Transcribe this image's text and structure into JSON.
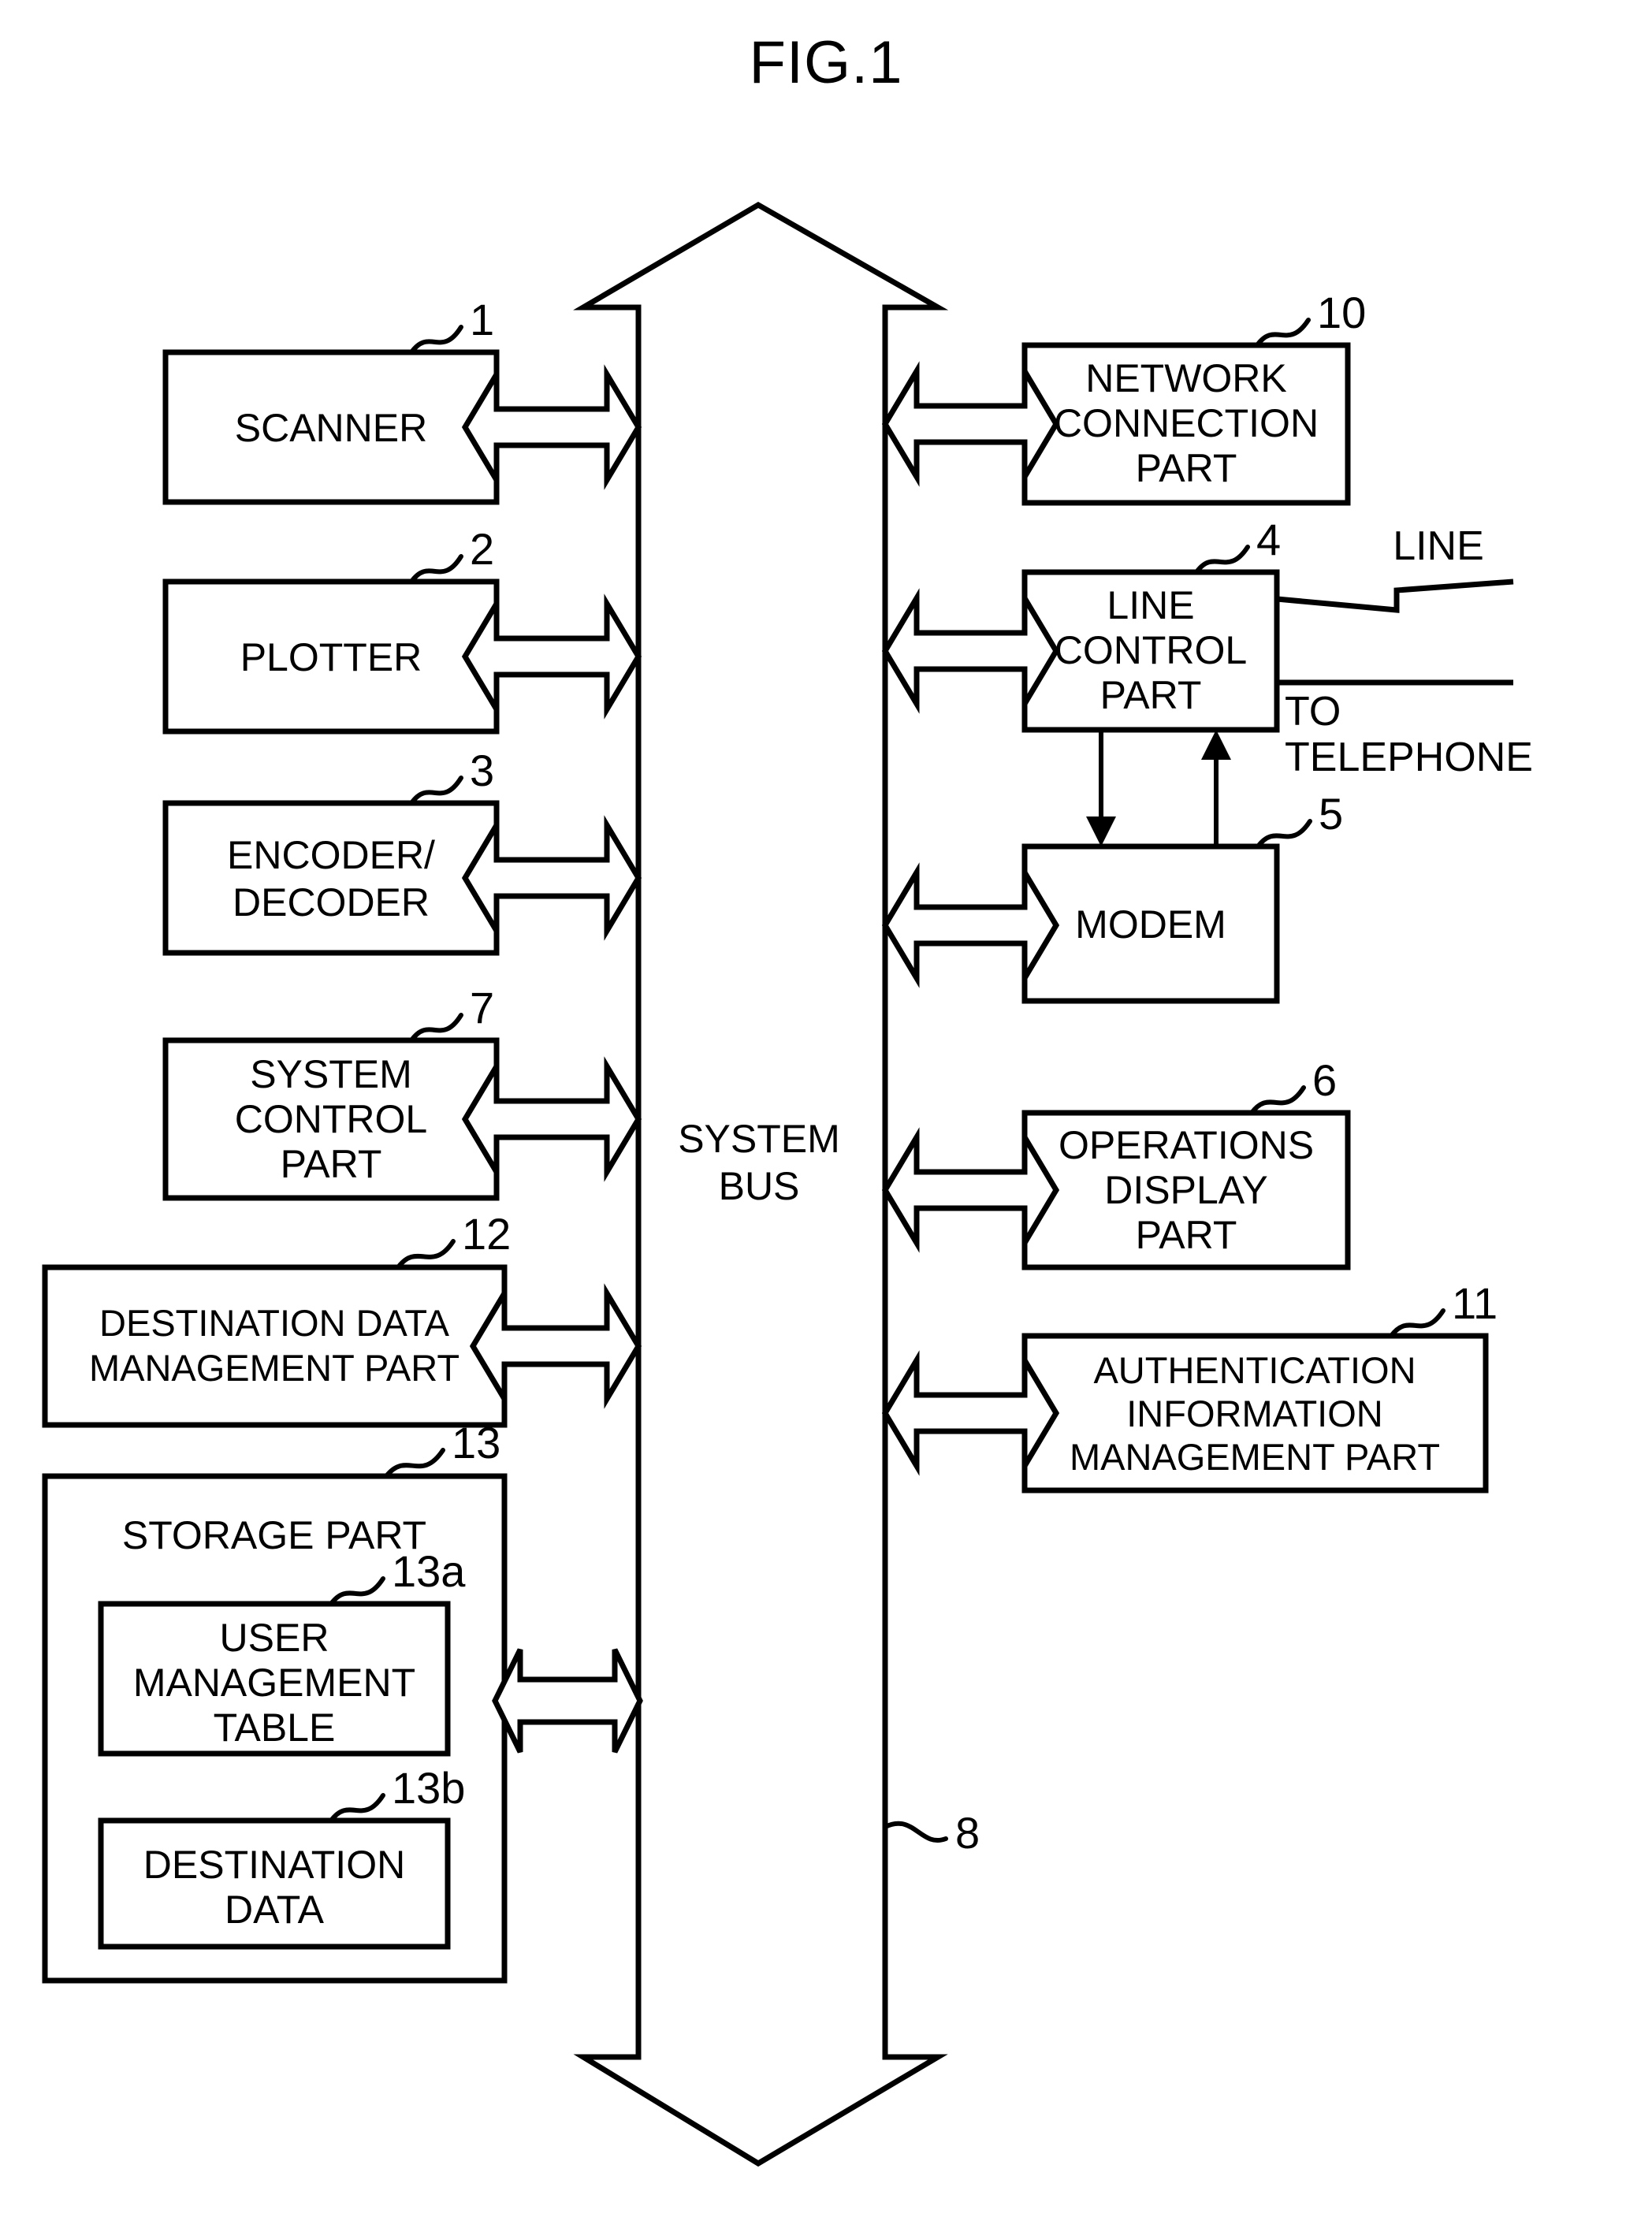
{
  "figure": {
    "title": "FIG.1",
    "type": "patent-block-diagram",
    "description": "Facsimile apparatus block diagram with system bus"
  },
  "bus": {
    "label_line1": "SYSTEM",
    "label_line2": "BUS",
    "ref": "8"
  },
  "left_blocks": [
    {
      "id": "scanner",
      "ref": "1",
      "lines": [
        "SCANNER"
      ]
    },
    {
      "id": "plotter",
      "ref": "2",
      "lines": [
        "PLOTTER"
      ]
    },
    {
      "id": "encoder",
      "ref": "3",
      "lines": [
        "ENCODER/",
        "DECODER"
      ]
    },
    {
      "id": "system-control",
      "ref": "7",
      "lines": [
        "SYSTEM",
        "CONTROL",
        "PART"
      ]
    },
    {
      "id": "dest-data-mgmt",
      "ref": "12",
      "lines": [
        "DESTINATION DATA",
        "MANAGEMENT PART"
      ]
    },
    {
      "id": "storage",
      "ref": "13",
      "lines": [
        "STORAGE PART"
      ]
    }
  ],
  "storage_children": [
    {
      "id": "user-mgmt-table",
      "ref": "13a",
      "lines": [
        "USER",
        "MANAGEMENT",
        "TABLE"
      ]
    },
    {
      "id": "destination-data",
      "ref": "13b",
      "lines": [
        "DESTINATION",
        "DATA"
      ]
    }
  ],
  "right_blocks": [
    {
      "id": "network-conn",
      "ref": "10",
      "lines": [
        "NETWORK",
        "CONNECTION",
        "PART"
      ]
    },
    {
      "id": "line-control",
      "ref": "4",
      "lines": [
        "LINE",
        "CONTROL",
        "PART"
      ]
    },
    {
      "id": "modem",
      "ref": "5",
      "lines": [
        "MODEM"
      ]
    },
    {
      "id": "operations",
      "ref": "6",
      "lines": [
        "OPERATIONS",
        "DISPLAY",
        "PART"
      ]
    },
    {
      "id": "auth-info",
      "ref": "11",
      "lines": [
        "AUTHENTICATION",
        "INFORMATION",
        "MANAGEMENT PART"
      ]
    }
  ],
  "external_labels": {
    "line": "LINE",
    "telephone_line1": "TO",
    "telephone_line2": "TELEPHONE"
  },
  "colors": {
    "stroke": "#000000",
    "fill": "#ffffff",
    "background": "#ffffff"
  }
}
